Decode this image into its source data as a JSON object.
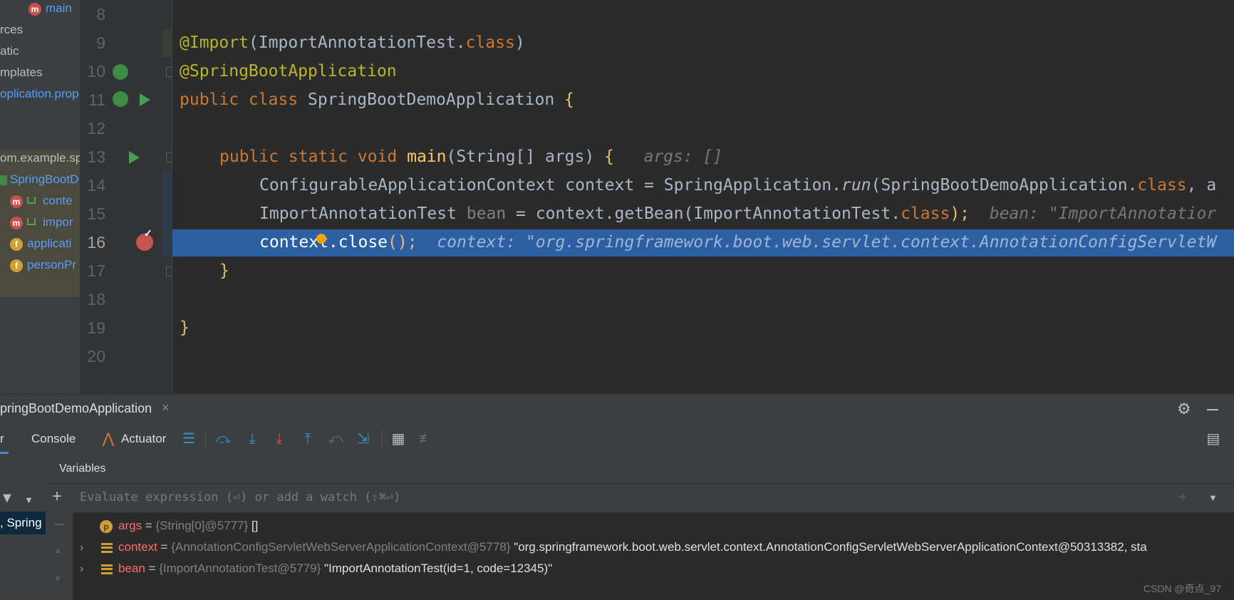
{
  "project_tree": {
    "items": [
      {
        "label": "main",
        "badge": "m"
      },
      {
        "label": "rces"
      },
      {
        "label": "atic"
      },
      {
        "label": "mplates"
      },
      {
        "label": "oplication.prop"
      },
      {
        "label": "om.example.sp"
      },
      {
        "label": "SpringBootD"
      },
      {
        "label": "conte",
        "badge": "m"
      },
      {
        "label": "impor",
        "badge": "m"
      },
      {
        "label": "applicati",
        "badge": "f"
      },
      {
        "label": "personPr",
        "badge": "f"
      }
    ]
  },
  "editor": {
    "line_numbers": [
      "8",
      "9",
      "10",
      "11",
      "12",
      "13",
      "14",
      "15",
      "16",
      "17",
      "18",
      "19",
      "20"
    ],
    "current_line": "16",
    "lines": {
      "l9": {
        "t1": "@Import",
        "t2": "(ImportAnnotationTest.",
        "t3": "class",
        "t4": ")"
      },
      "l10": {
        "t1": "@SpringBootApplication"
      },
      "l11": {
        "t1": "public class ",
        "t2": "SpringBootDemoApplication ",
        "t3": "{"
      },
      "l13": {
        "t1": "public static void ",
        "t2": "main",
        "t3": "(String[] args) ",
        "t4": "{",
        "hint": "args: []"
      },
      "l14": {
        "t1": "ConfigurableApplicationContext context = SpringApplication.",
        "t2": "run",
        "t3": "(SpringBootDemoApplication.",
        "t4": "class",
        "t5": ", a"
      },
      "l15": {
        "t1": "ImportAnnotationTest ",
        "t2": "bean",
        "t3": " = context.getBean(ImportAnnotationTest.",
        "t4": "class",
        "t5": ");",
        "hint": "bean: \"ImportAnnotatior"
      },
      "l16": {
        "t1": "context.close",
        "t2": "();",
        "hint": "context: \"org.springframework.boot.web.servlet.context.AnnotationConfigServletW"
      },
      "l17": {
        "t1": "}"
      },
      "l19": {
        "t1": "}"
      }
    }
  },
  "debug": {
    "run_config": "pringBootDemoApplication",
    "close_glyph": "×",
    "tabs": {
      "debugger_partial": "r",
      "console": "Console",
      "actuator": "Actuator"
    },
    "variables_title": "Variables",
    "frame_label": ", Spring",
    "eval_placeholder": "Evaluate expression (⏎) or add a watch (⇧⌘⏎)",
    "vars": [
      {
        "name": "args",
        "type": "{String[0]@5777}",
        "value": " []"
      },
      {
        "name": "context",
        "type": "{AnnotationConfigServletWebServerApplicationContext@5778}",
        "value": " \"org.springframework.boot.web.servlet.context.AnnotationConfigServletWebServerApplicationContext@50313382, sta"
      },
      {
        "name": "bean",
        "type": "{ImportAnnotationTest@5779}",
        "value": " \"ImportAnnotationTest(id=1, code=12345)\""
      }
    ]
  },
  "watermark": "CSDN @奇点_97"
}
